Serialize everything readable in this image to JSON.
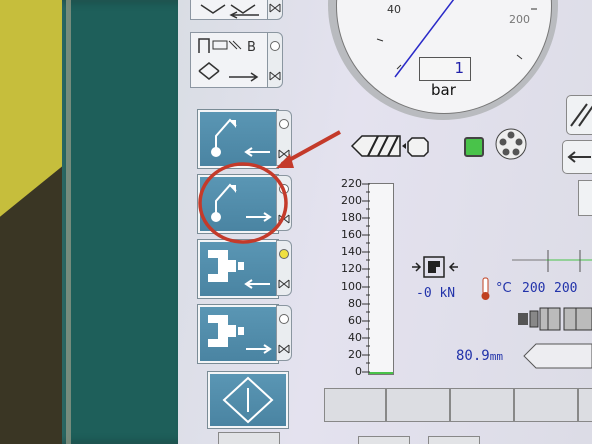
{
  "gauge": {
    "tick_40": "40",
    "tick_200": "200",
    "value": "1",
    "unit": "bar"
  },
  "force": {
    "value": "-0",
    "unit": "kN"
  },
  "temperature": {
    "unit": "°C",
    "value_1": "200",
    "value_2": "200"
  },
  "position": {
    "value": "80.9",
    "unit": "mm"
  },
  "pressure_scale": {
    "ticks": [
      "220",
      "200",
      "180",
      "160",
      "140",
      "120",
      "100",
      "80",
      "60",
      "40",
      "20",
      "0"
    ],
    "fill_fraction": 0.0
  },
  "colors": {
    "button_blue": "#4f8cab",
    "status_green": "#49c34a",
    "annotation_red": "#c43a2a",
    "lamp_yellow": "#f0e040",
    "bezel_teal": "#1e5f5a"
  },
  "buttons": [
    {
      "name": "core-pull-button",
      "icon": "core-retract-icon"
    },
    {
      "name": "core-in-button",
      "icon": "core-insert-icon"
    },
    {
      "name": "ejector-retract-button",
      "icon": "ejector-back-icon"
    },
    {
      "name": "ejector-forward-button",
      "icon": "ejector-forward-icon"
    }
  ]
}
